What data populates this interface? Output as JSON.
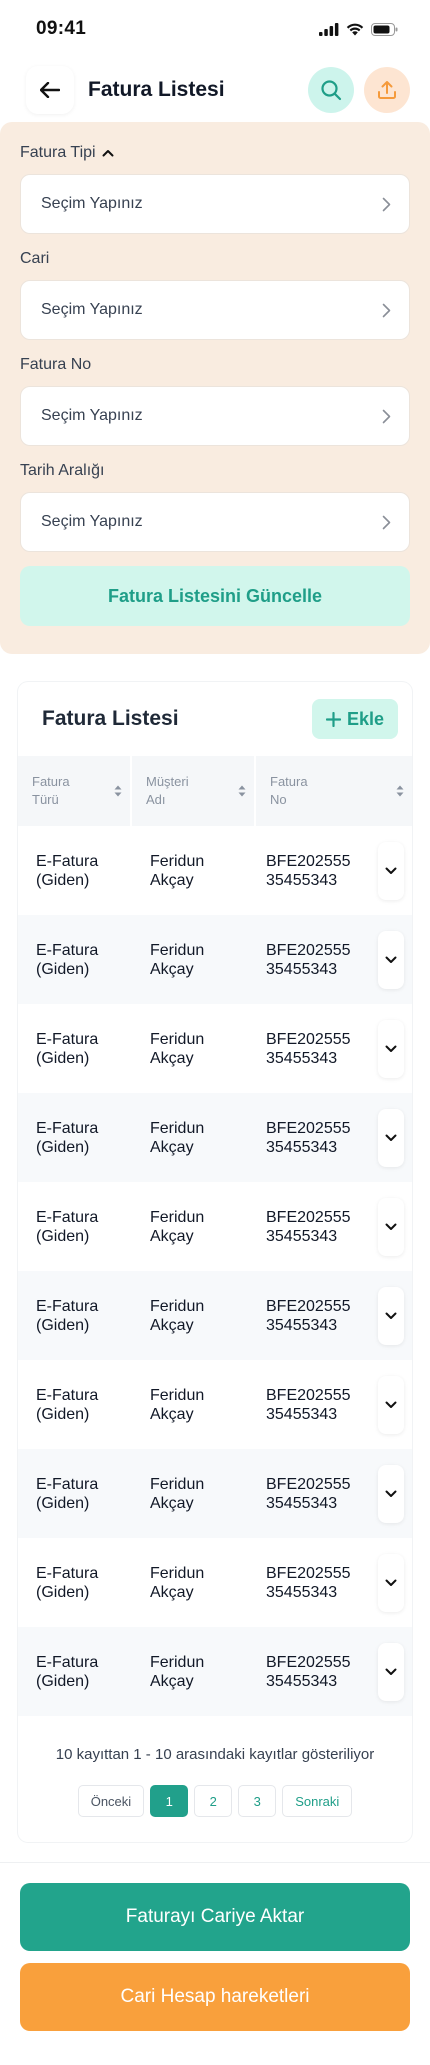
{
  "status": {
    "time": "09:41"
  },
  "header": {
    "title": "Fatura Listesi"
  },
  "filters": {
    "fields": [
      {
        "label": "Fatura Tipi",
        "value": "Seçim Yapınız"
      },
      {
        "label": "Cari",
        "value": "Seçim Yapınız"
      },
      {
        "label": "Fatura No",
        "value": "Seçim Yapınız"
      },
      {
        "label": "Tarih Aralığı",
        "value": "Seçim Yapınız"
      }
    ],
    "update_label": "Fatura Listesini Güncelle"
  },
  "list": {
    "title": "Fatura Listesi",
    "add_label": "Ekle",
    "columns": [
      {
        "line1": "Fatura",
        "line2": "Türü"
      },
      {
        "line1": "Müşteri",
        "line2": "Adı"
      },
      {
        "line1": "Fatura",
        "line2": "No"
      }
    ],
    "rows": [
      {
        "type1": "E-Fatura",
        "type2": "(Giden)",
        "name1": "Feridun",
        "name2": "Akçay",
        "no1": "BFE202555",
        "no2": "35455343"
      },
      {
        "type1": "E-Fatura",
        "type2": "(Giden)",
        "name1": "Feridun",
        "name2": "Akçay",
        "no1": "BFE202555",
        "no2": "35455343"
      },
      {
        "type1": "E-Fatura",
        "type2": "(Giden)",
        "name1": "Feridun",
        "name2": "Akçay",
        "no1": "BFE202555",
        "no2": "35455343"
      },
      {
        "type1": "E-Fatura",
        "type2": "(Giden)",
        "name1": "Feridun",
        "name2": "Akçay",
        "no1": "BFE202555",
        "no2": "35455343"
      },
      {
        "type1": "E-Fatura",
        "type2": "(Giden)",
        "name1": "Feridun",
        "name2": "Akçay",
        "no1": "BFE202555",
        "no2": "35455343"
      },
      {
        "type1": "E-Fatura",
        "type2": "(Giden)",
        "name1": "Feridun",
        "name2": "Akçay",
        "no1": "BFE202555",
        "no2": "35455343"
      },
      {
        "type1": "E-Fatura",
        "type2": "(Giden)",
        "name1": "Feridun",
        "name2": "Akçay",
        "no1": "BFE202555",
        "no2": "35455343"
      },
      {
        "type1": "E-Fatura",
        "type2": "(Giden)",
        "name1": "Feridun",
        "name2": "Akçay",
        "no1": "BFE202555",
        "no2": "35455343"
      },
      {
        "type1": "E-Fatura",
        "type2": "(Giden)",
        "name1": "Feridun",
        "name2": "Akçay",
        "no1": "BFE202555",
        "no2": "35455343"
      },
      {
        "type1": "E-Fatura",
        "type2": "(Giden)",
        "name1": "Feridun",
        "name2": "Akçay",
        "no1": "BFE202555",
        "no2": "35455343"
      }
    ],
    "summary": "10 kayıttan 1 - 10 arasındaki kayıtlar gösteriliyor",
    "pager": {
      "prev": "Önceki",
      "pages": [
        "1",
        "2",
        "3"
      ],
      "next": "Sonraki",
      "active_page": "1"
    }
  },
  "actions": {
    "transfer_label": "Faturayı Cariye Aktar",
    "movements_label": "Cari Hesap hareketleri"
  },
  "colors": {
    "accent_green": "#22a48c",
    "accent_orange": "#f9a03c",
    "filter_bg": "#f9ece0",
    "mint": "#d1f6ec"
  },
  "icons": [
    "back-arrow-icon",
    "search-icon",
    "upload-icon",
    "chevron-up-icon",
    "chevron-right-icon",
    "plus-icon",
    "sort-icon",
    "chevron-down-icon",
    "signal-icon",
    "wifi-icon",
    "battery-icon"
  ]
}
